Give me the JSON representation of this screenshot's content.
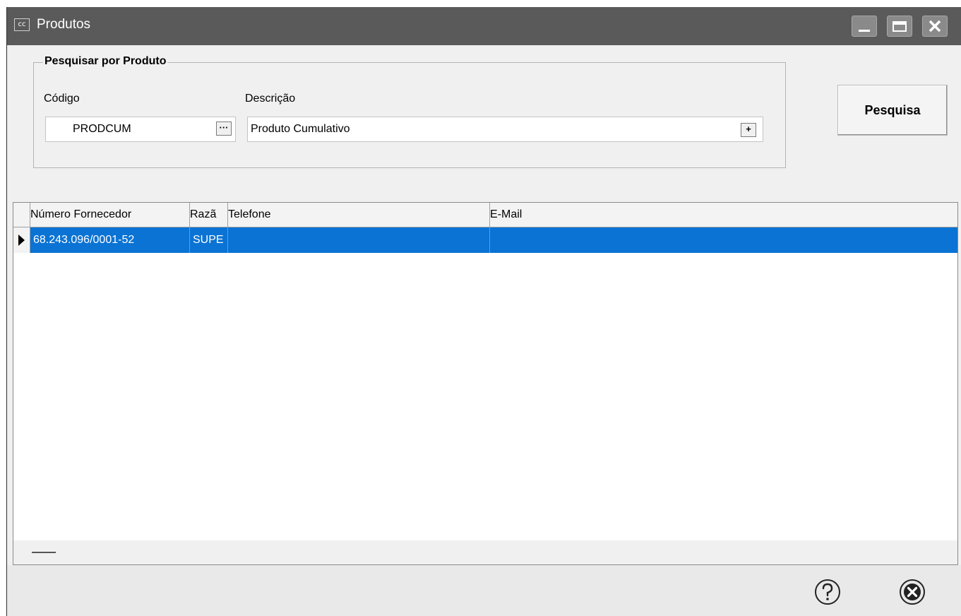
{
  "window": {
    "icon_text": "cc",
    "title": "Produtos",
    "controls": {
      "minimize": "minimize-icon",
      "maximize": "maximize-icon",
      "close": "close-icon"
    }
  },
  "search": {
    "group_title": "Pesquisar por Produto",
    "codigo_label": "Código",
    "codigo_value": "PRODCUM",
    "codigo_lookup_btn": "···",
    "descricao_label": "Descrição",
    "descricao_value": "Produto Cumulativo",
    "descricao_expand_btn": "+",
    "button_label": "Pesquisa"
  },
  "grid": {
    "columns": [
      "Número Fornecedor",
      "Razã",
      "Telefone",
      "E-Mail"
    ],
    "rows": [
      {
        "numero": "68.243.096/0001-52",
        "razao": "SUPE",
        "telefone": "",
        "email": ""
      }
    ],
    "selected_row_color": "#0a73d4"
  },
  "footer": {
    "help_icon": "help-icon",
    "close_icon": "close-circle-icon"
  }
}
